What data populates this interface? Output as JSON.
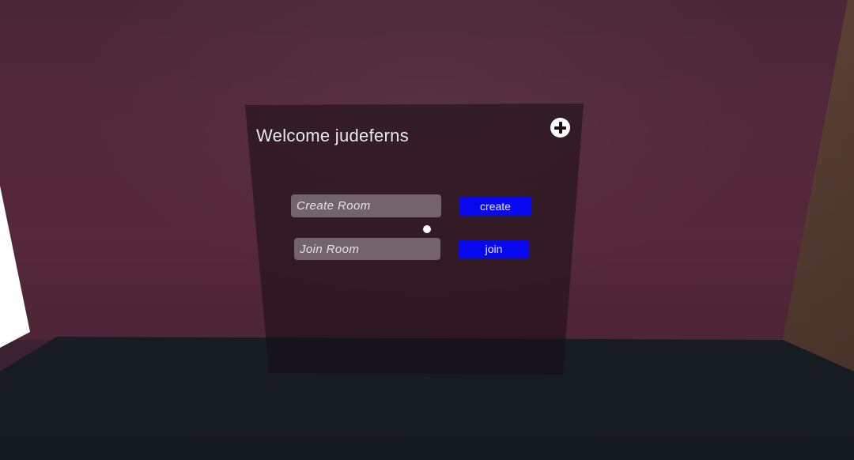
{
  "panel": {
    "welcome_text": "Welcome judeferns",
    "add_icon": "plus-circle-icon"
  },
  "create_room": {
    "placeholder": "Create Room",
    "value": "",
    "button_label": "create"
  },
  "join_room": {
    "placeholder": "Join Room",
    "value": "",
    "button_label": "join"
  },
  "pointer": {
    "icon": "pointer-dot"
  },
  "colors": {
    "button_bg": "#0808f0",
    "button_text": "#e9e9ff",
    "wall": "#52283a",
    "floor": "#1a2026"
  }
}
